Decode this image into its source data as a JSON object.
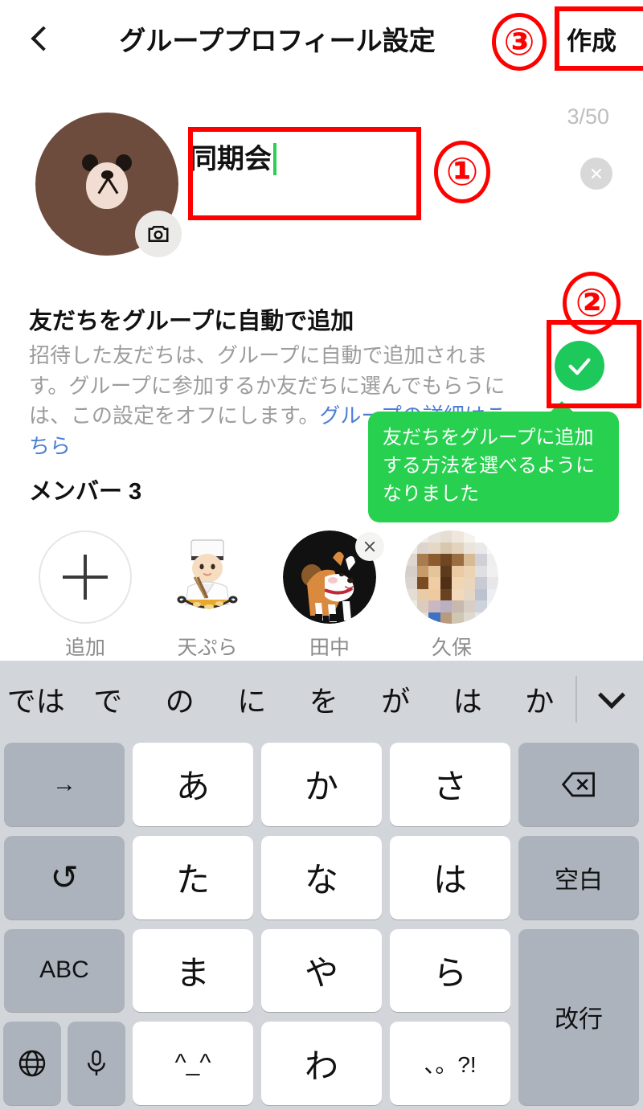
{
  "header": {
    "back_icon": "chevron-left-icon",
    "title": "グループプロフィール設定",
    "create_label": "作成"
  },
  "profile": {
    "avatar_alt": "brown-bear-avatar",
    "camera_icon": "camera-icon",
    "group_name_value": "同期会",
    "char_counter": "3/50",
    "clear_icon": "close-circle-icon"
  },
  "auto_add": {
    "title": "友だちをグループに自動で追加",
    "description_part1": "招待した友だちは、グループに自動で追加されます。グループに参加するか友だちに選んでもらうには、この設定をオフにします。",
    "link_text": "グループの詳細はこちら",
    "toggle_state": "on",
    "toggle_icon": "check-icon",
    "toggle_color": "#1dc95a"
  },
  "tooltip": {
    "text": "友だちをグループに追加する方法を選べるようになりました",
    "background_color": "#27d14f",
    "text_color": "#ffffff"
  },
  "members": {
    "heading": "メンバー 3",
    "items": [
      {
        "label": "追加",
        "type": "add-button",
        "icon": "plus-icon"
      },
      {
        "label": "天ぷら",
        "type": "member",
        "avatar": "tempura-chef-illustration"
      },
      {
        "label": "田中",
        "type": "member",
        "avatar": "shiba-dog-illustration",
        "removable": true,
        "remove_icon": "close-icon"
      },
      {
        "label": "久保",
        "type": "member",
        "avatar": "mosaic-blurred-photo"
      }
    ]
  },
  "keyboard": {
    "suggestions": [
      "では",
      "で",
      "の",
      "に",
      "を",
      "が",
      "は",
      "か"
    ],
    "collapse_icon": "chevron-down-icon",
    "keys": [
      {
        "label": "→",
        "type": "fn",
        "name": "arrow-right-key"
      },
      {
        "label": "あ",
        "type": "char",
        "name": "key-a"
      },
      {
        "label": "か",
        "type": "char",
        "name": "key-ka"
      },
      {
        "label": "さ",
        "type": "char",
        "name": "key-sa"
      },
      {
        "label": "",
        "type": "fn",
        "name": "backspace-key",
        "icon": "backspace-icon"
      },
      {
        "label": "↺",
        "type": "fn",
        "name": "undo-key"
      },
      {
        "label": "た",
        "type": "char",
        "name": "key-ta"
      },
      {
        "label": "な",
        "type": "char",
        "name": "key-na"
      },
      {
        "label": "は",
        "type": "char",
        "name": "key-ha"
      },
      {
        "label": "空白",
        "type": "fn",
        "name": "space-key"
      },
      {
        "label": "ABC",
        "type": "fn",
        "name": "abc-key"
      },
      {
        "label": "ま",
        "type": "char",
        "name": "key-ma"
      },
      {
        "label": "や",
        "type": "char",
        "name": "key-ya"
      },
      {
        "label": "ら",
        "type": "char",
        "name": "key-ra"
      },
      {
        "label": "改行",
        "type": "fn",
        "name": "return-key"
      },
      {
        "label": "",
        "type": "fn",
        "name": "globe-key",
        "icon": "globe-icon"
      },
      {
        "label": "",
        "type": "fn",
        "name": "mic-key",
        "icon": "microphone-icon"
      },
      {
        "label": "^_^",
        "type": "char",
        "name": "key-emoticon"
      },
      {
        "label": "わ",
        "type": "char",
        "name": "key-wa"
      },
      {
        "label": "、。?!",
        "type": "char",
        "name": "key-punctuation"
      }
    ]
  },
  "annotations": {
    "marker1": "①",
    "marker2": "②",
    "marker3": "③",
    "color": "#ff0000"
  }
}
